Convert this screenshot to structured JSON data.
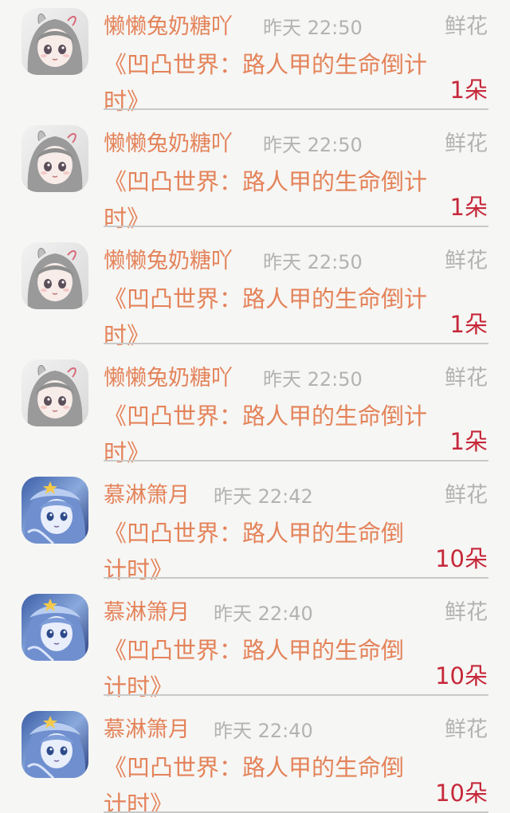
{
  "colors": {
    "name": "#e4835a",
    "time": "#b3b3b3",
    "kind": "#b3b3b3",
    "title": "#e4835a",
    "amount": "#c6283a",
    "background": "#f6f6f4"
  },
  "items": [
    {
      "sender": "懒懒兔奶糖吖",
      "time": "昨天 22:50",
      "gift_type": "鲜花",
      "book_title": "《凹凸世界：路人甲的生命倒计时》",
      "amount": "1朵",
      "avatar_icon": "gray-haired-anime-girl-avatar-icon"
    },
    {
      "sender": "懒懒兔奶糖吖",
      "time": "昨天 22:50",
      "gift_type": "鲜花",
      "book_title": "《凹凸世界：路人甲的生命倒计时》",
      "amount": "1朵",
      "avatar_icon": "gray-haired-anime-girl-avatar-icon"
    },
    {
      "sender": "懒懒兔奶糖吖",
      "time": "昨天 22:50",
      "gift_type": "鲜花",
      "book_title": "《凹凸世界：路人甲的生命倒计时》",
      "amount": "1朵",
      "avatar_icon": "gray-haired-anime-girl-avatar-icon"
    },
    {
      "sender": "懒懒兔奶糖吖",
      "time": "昨天 22:50",
      "gift_type": "鲜花",
      "book_title": "《凹凸世界：路人甲的生命倒计时》",
      "amount": "1朵",
      "avatar_icon": "gray-haired-anime-girl-avatar-icon"
    },
    {
      "sender": "慕淋箫月",
      "time": "昨天 22:42",
      "gift_type": "鲜花",
      "book_title": "《凹凸世界：路人甲的生命倒计时》",
      "amount": "10朵",
      "avatar_icon": "blue-haired-anime-girl-avatar-icon"
    },
    {
      "sender": "慕淋箫月",
      "time": "昨天 22:40",
      "gift_type": "鲜花",
      "book_title": "《凹凸世界：路人甲的生命倒计时》",
      "amount": "10朵",
      "avatar_icon": "blue-haired-anime-girl-avatar-icon"
    },
    {
      "sender": "慕淋箫月",
      "time": "昨天 22:40",
      "gift_type": "鲜花",
      "book_title": "《凹凸世界：路人甲的生命倒计时》",
      "amount": "10朵",
      "avatar_icon": "blue-haired-anime-girl-avatar-icon"
    }
  ]
}
